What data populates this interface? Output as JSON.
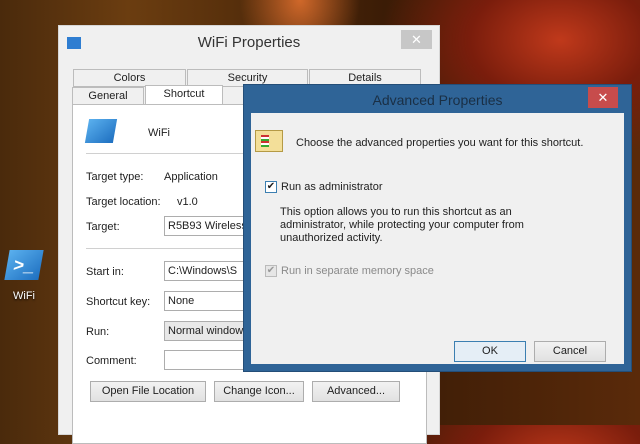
{
  "desktop": {
    "icon_label": "WiFi"
  },
  "props": {
    "title": "WiFi  Properties",
    "close": "✕",
    "tabs_row1": [
      "Colors",
      "Security",
      "Details"
    ],
    "tabs_row2": [
      "General",
      "Shortcut"
    ],
    "name": "WiFi",
    "target_type_label": "Target type:",
    "target_type": "Application",
    "target_location_label": "Target location:",
    "target_location": "v1.0",
    "target_label": "Target:",
    "target": "R5B93 Wireless",
    "start_in_label": "Start in:",
    "start_in": "C:\\Windows\\S",
    "shortcut_key_label": "Shortcut key:",
    "shortcut_key": "None",
    "run_label": "Run:",
    "run": "Normal window",
    "comment_label": "Comment:",
    "comment": "",
    "buttons": {
      "open": "Open File Location",
      "change": "Change Icon...",
      "advanced": "Advanced..."
    }
  },
  "advanced": {
    "title": "Advanced Properties",
    "close": "✕",
    "intro": "Choose the advanced properties you want for this shortcut.",
    "run_admin": "Run as administrator",
    "run_admin_checked": true,
    "description": "This option allows you to run this shortcut as an administrator, while protecting your computer from unauthorized activity.",
    "separate_memory": "Run in separate memory space",
    "separate_memory_checked": true,
    "ok": "OK",
    "cancel": "Cancel",
    "check": "✔"
  }
}
